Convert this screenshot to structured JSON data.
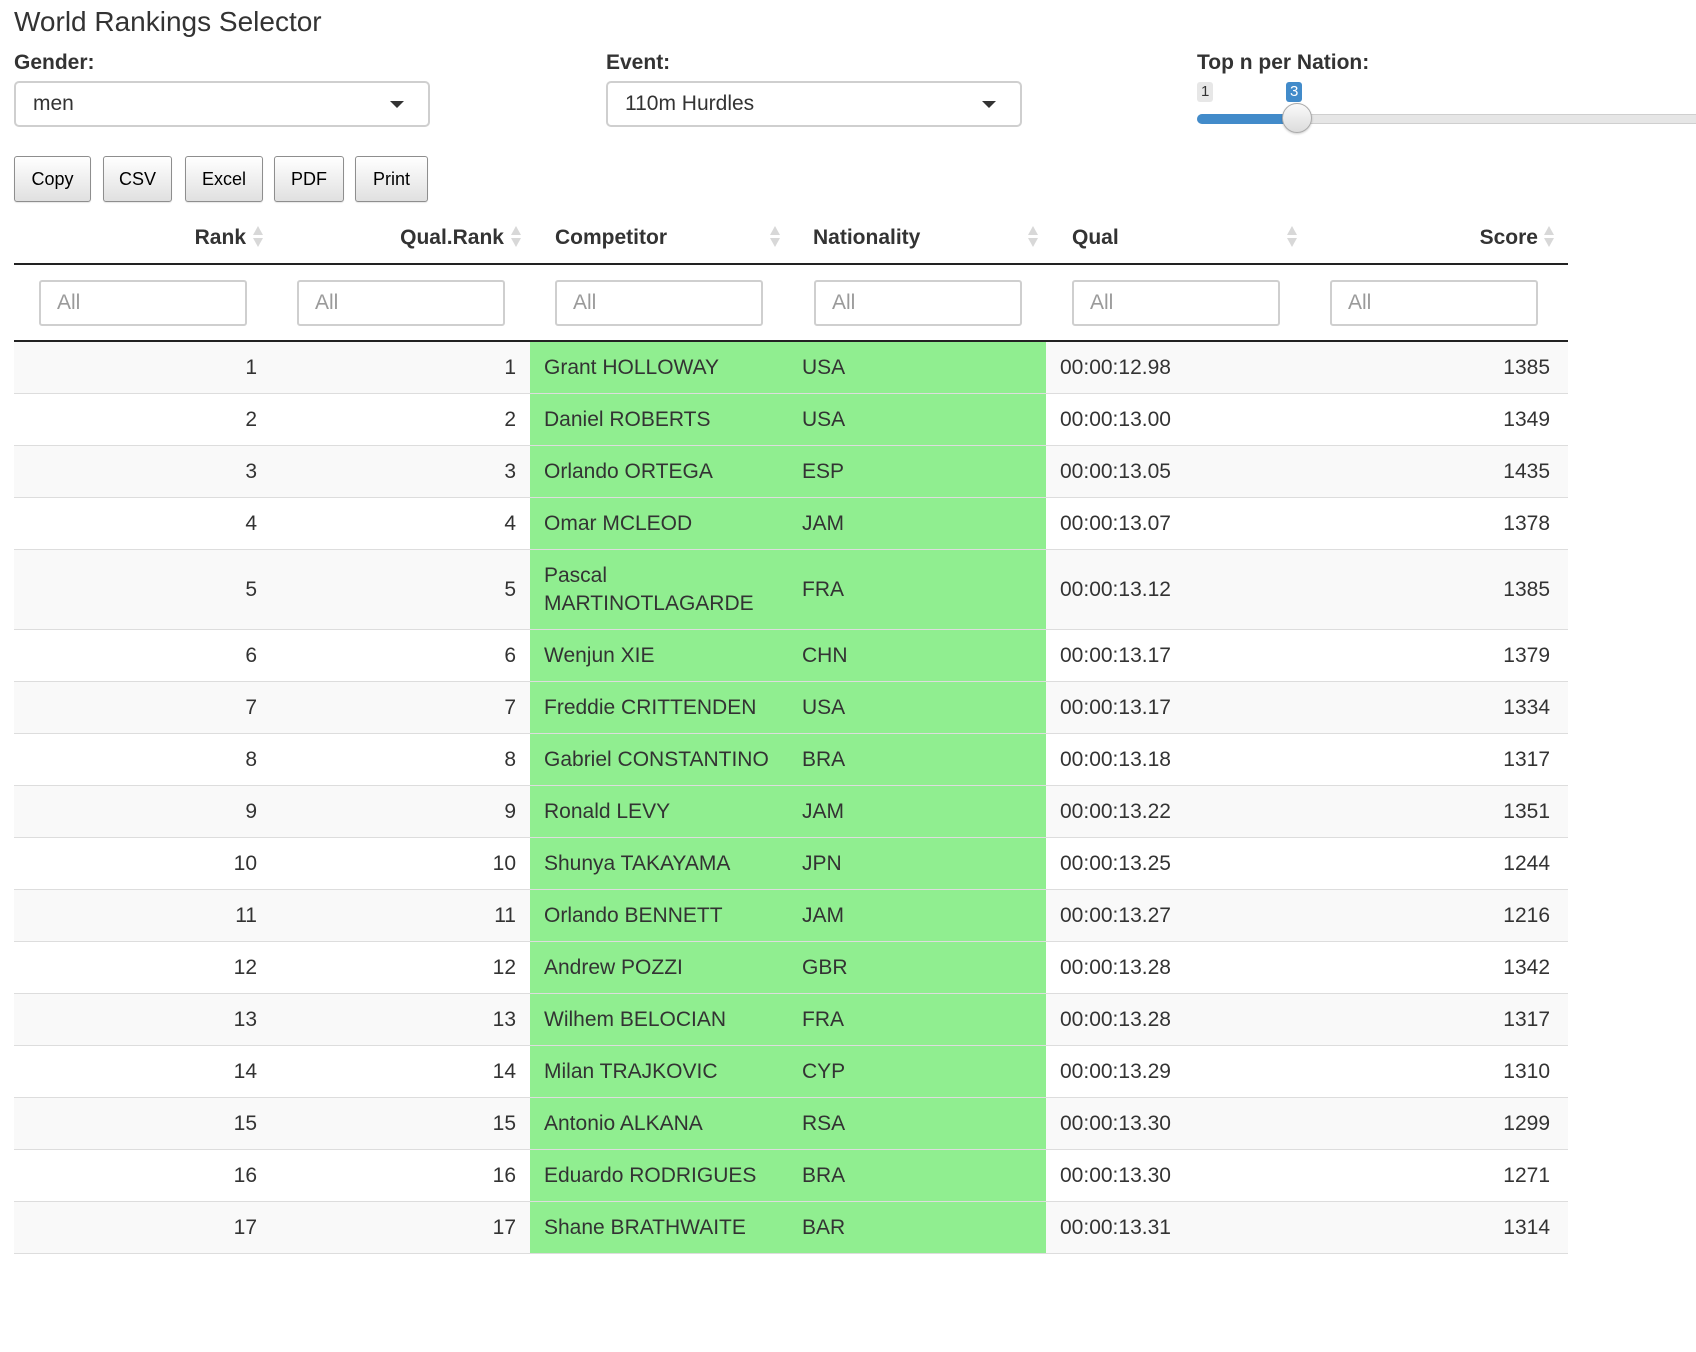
{
  "title": "World Rankings Selector",
  "controls": {
    "gender_label": "Gender:",
    "gender_value": "men",
    "event_label": "Event:",
    "event_value": "110m Hurdles",
    "topn_label": "Top n per Nation:",
    "slider_min": "1",
    "slider_value": "3"
  },
  "buttons": {
    "copy": "Copy",
    "csv": "CSV",
    "excel": "Excel",
    "pdf": "PDF",
    "print": "Print"
  },
  "table": {
    "headers": {
      "rank": "Rank",
      "qual_rank": "Qual.Rank",
      "competitor": "Competitor",
      "nationality": "Nationality",
      "qual": "Qual",
      "score": "Score"
    },
    "filter_placeholder": "All",
    "highlight_color": "#90ee90",
    "rows": [
      {
        "rank": "1",
        "qual_rank": "1",
        "competitor": "Grant HOLLOWAY",
        "nationality": "USA",
        "qual": "00:00:12.98",
        "score": "1385"
      },
      {
        "rank": "2",
        "qual_rank": "2",
        "competitor": "Daniel ROBERTS",
        "nationality": "USA",
        "qual": "00:00:13.00",
        "score": "1349"
      },
      {
        "rank": "3",
        "qual_rank": "3",
        "competitor": "Orlando ORTEGA",
        "nationality": "ESP",
        "qual": "00:00:13.05",
        "score": "1435"
      },
      {
        "rank": "4",
        "qual_rank": "4",
        "competitor": "Omar MCLEOD",
        "nationality": "JAM",
        "qual": "00:00:13.07",
        "score": "1378"
      },
      {
        "rank": "5",
        "qual_rank": "5",
        "competitor": "Pascal MARTINOTLAGARDE",
        "nationality": "FRA",
        "qual": "00:00:13.12",
        "score": "1385"
      },
      {
        "rank": "6",
        "qual_rank": "6",
        "competitor": "Wenjun XIE",
        "nationality": "CHN",
        "qual": "00:00:13.17",
        "score": "1379"
      },
      {
        "rank": "7",
        "qual_rank": "7",
        "competitor": "Freddie CRITTENDEN",
        "nationality": "USA",
        "qual": "00:00:13.17",
        "score": "1334"
      },
      {
        "rank": "8",
        "qual_rank": "8",
        "competitor": "Gabriel CONSTANTINO",
        "nationality": "BRA",
        "qual": "00:00:13.18",
        "score": "1317"
      },
      {
        "rank": "9",
        "qual_rank": "9",
        "competitor": "Ronald LEVY",
        "nationality": "JAM",
        "qual": "00:00:13.22",
        "score": "1351"
      },
      {
        "rank": "10",
        "qual_rank": "10",
        "competitor": "Shunya TAKAYAMA",
        "nationality": "JPN",
        "qual": "00:00:13.25",
        "score": "1244"
      },
      {
        "rank": "11",
        "qual_rank": "11",
        "competitor": "Orlando BENNETT",
        "nationality": "JAM",
        "qual": "00:00:13.27",
        "score": "1216"
      },
      {
        "rank": "12",
        "qual_rank": "12",
        "competitor": "Andrew POZZI",
        "nationality": "GBR",
        "qual": "00:00:13.28",
        "score": "1342"
      },
      {
        "rank": "13",
        "qual_rank": "13",
        "competitor": "Wilhem BELOCIAN",
        "nationality": "FRA",
        "qual": "00:00:13.28",
        "score": "1317"
      },
      {
        "rank": "14",
        "qual_rank": "14",
        "competitor": "Milan TRAJKOVIC",
        "nationality": "CYP",
        "qual": "00:00:13.29",
        "score": "1310"
      },
      {
        "rank": "15",
        "qual_rank": "15",
        "competitor": "Antonio ALKANA",
        "nationality": "RSA",
        "qual": "00:00:13.30",
        "score": "1299"
      },
      {
        "rank": "16",
        "qual_rank": "16",
        "competitor": "Eduardo RODRIGUES",
        "nationality": "BRA",
        "qual": "00:00:13.30",
        "score": "1271"
      },
      {
        "rank": "17",
        "qual_rank": "17",
        "competitor": "Shane BRATHWAITE",
        "nationality": "BAR",
        "qual": "00:00:13.31",
        "score": "1314"
      }
    ]
  }
}
